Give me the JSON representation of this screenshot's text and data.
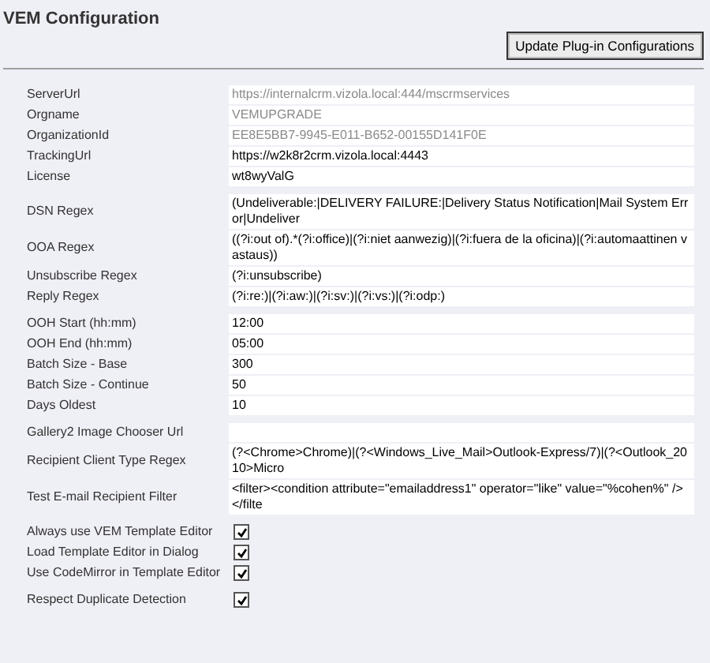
{
  "title": "VEM Configuration",
  "update_button": "Update Plug-in Configurations",
  "groups": [
    {
      "fields": [
        {
          "kind": "text",
          "label": "ServerUrl",
          "value": "https://internalcrm.vizola.local:444/mscrmservices",
          "disabled": true
        },
        {
          "kind": "text",
          "label": "Orgname",
          "value": "VEMUPGRADE",
          "disabled": true
        },
        {
          "kind": "text",
          "label": "OrganizationId",
          "value": "EE8E5BB7-9945-E011-B652-00155D141F0E",
          "disabled": true
        },
        {
          "kind": "text",
          "label": "TrackingUrl",
          "value": "https://w2k8r2crm.vizola.local:4443",
          "disabled": false
        },
        {
          "kind": "text",
          "label": "License",
          "value": "wt8wyValG",
          "disabled": false
        }
      ]
    },
    {
      "fields": [
        {
          "kind": "text",
          "label": "DSN Regex",
          "value": "(Undeliverable:|DELIVERY FAILURE:|Delivery Status Notification|Mail System Error|Undeliver",
          "disabled": false
        },
        {
          "kind": "text",
          "label": "OOA Regex",
          "value": "((?i:out of).*(?i:office)|(?i:niet aanwezig)|(?i:fuera de la oficina)|(?i:automaattinen vastaus))",
          "disabled": false
        },
        {
          "kind": "text",
          "label": "Unsubscribe Regex",
          "value": "(?i:unsubscribe)",
          "disabled": false
        },
        {
          "kind": "text",
          "label": "Reply Regex",
          "value": "(?i:re:)|(?i:aw:)|(?i:sv:)|(?i:vs:)|(?i:odp:)",
          "disabled": false
        }
      ]
    },
    {
      "fields": [
        {
          "kind": "text",
          "label": "OOH Start (hh:mm)",
          "value": "12:00",
          "disabled": false
        },
        {
          "kind": "text",
          "label": "OOH End (hh:mm)",
          "value": "05:00",
          "disabled": false
        },
        {
          "kind": "text",
          "label": "Batch Size - Base",
          "value": "300",
          "disabled": false
        },
        {
          "kind": "text",
          "label": "Batch Size - Continue",
          "value": "50",
          "disabled": false
        },
        {
          "kind": "text",
          "label": "Days Oldest",
          "value": "10",
          "disabled": false
        }
      ]
    },
    {
      "fields": [
        {
          "kind": "text",
          "label": "Gallery2 Image Chooser Url"
        },
        {
          "kind": "text",
          "label": "Recipient Client Type Regex",
          "value": "(?<Chrome>Chrome)|(?<Windows_Live_Mail>Outlook-Express/7)|(?<Outlook_2010>Micro",
          "disabled": false
        },
        {
          "kind": "text",
          "label": "Test E-mail Recipient Filter",
          "value": "<filter><condition attribute=\"emailaddress1\" operator=\"like\" value=\"%cohen%\" /></filte",
          "disabled": false
        }
      ]
    },
    {
      "fields": [
        {
          "kind": "checkbox",
          "label": "Always use VEM Template Editor",
          "checked": true
        },
        {
          "kind": "checkbox",
          "label": "Load Template Editor in Dialog",
          "checked": true
        },
        {
          "kind": "checkbox",
          "label": "Use CodeMirror in Template Editor",
          "checked": true
        }
      ]
    },
    {
      "fields": [
        {
          "kind": "checkbox",
          "label": "Respect Duplicate Detection",
          "checked": true
        }
      ]
    }
  ]
}
